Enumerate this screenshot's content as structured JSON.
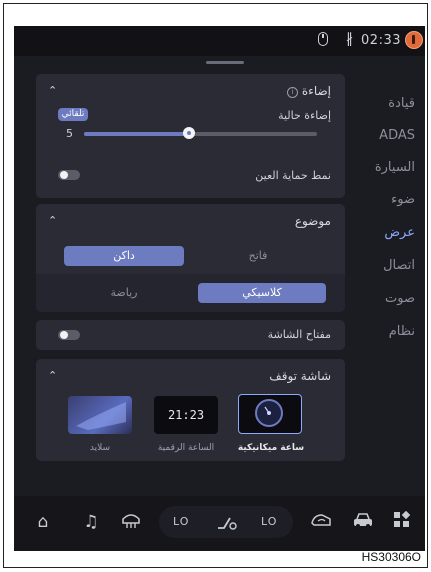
{
  "status_bar": {
    "time": "02:33",
    "bluetooth_icon": "bluetooth-icon",
    "mouse_icon": "mouse-icon",
    "profile_badge_icon": "driver-badge-icon"
  },
  "sidebar": {
    "items": [
      {
        "label": "قيادة"
      },
      {
        "label": "ADAS"
      },
      {
        "label": "السيارة"
      },
      {
        "label": "ضوء"
      },
      {
        "label": "عرض"
      },
      {
        "label": "اتصال"
      },
      {
        "label": "صوت"
      },
      {
        "label": "نظام"
      }
    ],
    "active_index": 4
  },
  "lighting": {
    "title": "إضاءة",
    "info_glyph": "i",
    "current_label": "إضاءة حالية",
    "auto_badge": "تلقائي",
    "brightness_value": "5",
    "brightness_fraction": 0.45,
    "eye_protect_label": "نمط حماية العين",
    "eye_protect_on": false
  },
  "theme": {
    "title": "موضوع",
    "mode_options": [
      "داكن",
      "فاتح"
    ],
    "mode_selected": "داكن",
    "style_options": [
      "رياضة",
      "كلاسيكي"
    ],
    "style_selected": "كلاسيكي"
  },
  "screen_switch": {
    "label": "مفتاح الشاشة",
    "on": false
  },
  "standby": {
    "title": "شاشة توقف",
    "options": [
      {
        "label": "سلايد",
        "selected": false
      },
      {
        "label": "الساعة الرقمية",
        "selected": false,
        "clock_text": "21:23"
      },
      {
        "label": "ساعة ميكانيكية",
        "selected": true
      }
    ]
  },
  "bottom_bar": {
    "left_temp": "LO",
    "right_temp": "LO",
    "icons": [
      "home-icon",
      "music-icon",
      "rear-defrost-icon",
      "fan-icon",
      "recirculation-icon",
      "car-icon",
      "apps-icon"
    ]
  },
  "caption": "HS30306O",
  "colors": {
    "accent": "#6d7bc0",
    "active_nav": "#8ea8ff",
    "panel": "#2a2b35",
    "background": "#1b1b22"
  }
}
